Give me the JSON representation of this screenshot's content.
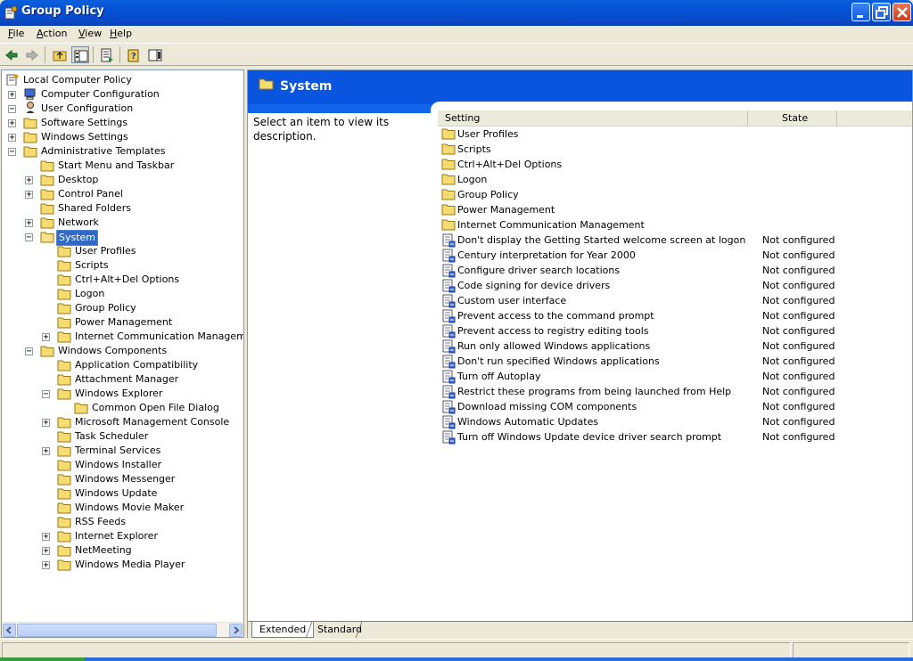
{
  "window": {
    "title": "Group Policy"
  },
  "menu": {
    "file": "File",
    "action": "Action",
    "view": "View",
    "help": "Help",
    "file_ul": "F",
    "file_rest": "ile",
    "action_ul": "A",
    "action_rest": "ction",
    "view_ul": "V",
    "view_rest": "iew",
    "help_ul": "H",
    "help_rest": "elp"
  },
  "tree": [
    {
      "label": "Local Computer Policy"
    },
    {
      "label": "Computer Configuration"
    },
    {
      "label": "User Configuration"
    },
    {
      "label": "Software Settings"
    },
    {
      "label": "Windows Settings"
    },
    {
      "label": "Administrative Templates"
    },
    {
      "label": "Start Menu and Taskbar"
    },
    {
      "label": "Desktop"
    },
    {
      "label": "Control Panel"
    },
    {
      "label": "Shared Folders"
    },
    {
      "label": "Network"
    },
    {
      "label": "System"
    },
    {
      "label": "User Profiles"
    },
    {
      "label": "Scripts"
    },
    {
      "label": "Ctrl+Alt+Del Options"
    },
    {
      "label": "Logon"
    },
    {
      "label": "Group Policy"
    },
    {
      "label": "Power Management"
    },
    {
      "label": "Internet Communication Manageme"
    },
    {
      "label": "Windows Components"
    },
    {
      "label": "Application Compatibility"
    },
    {
      "label": "Attachment Manager"
    },
    {
      "label": "Windows Explorer"
    },
    {
      "label": "Common Open File Dialog"
    },
    {
      "label": "Microsoft Management Console"
    },
    {
      "label": "Task Scheduler"
    },
    {
      "label": "Terminal Services"
    },
    {
      "label": "Windows Installer"
    },
    {
      "label": "Windows Messenger"
    },
    {
      "label": "Windows Update"
    },
    {
      "label": "Windows Movie Maker"
    },
    {
      "label": "RSS Feeds"
    },
    {
      "label": "Internet Explorer"
    },
    {
      "label": "NetMeeting"
    },
    {
      "label": "Windows Media Player"
    }
  ],
  "details": {
    "title": "System",
    "description": "Select an item to view its description.",
    "columns": {
      "setting": "Setting",
      "state": "State"
    },
    "folders": [
      "User Profiles",
      "Scripts",
      "Ctrl+Alt+Del Options",
      "Logon",
      "Group Policy",
      "Power Management",
      "Internet Communication Management"
    ],
    "settings": [
      {
        "name": "Don't display the Getting Started welcome screen at logon",
        "state": "Not configured"
      },
      {
        "name": "Century interpretation for Year 2000",
        "state": "Not configured"
      },
      {
        "name": "Configure driver search locations",
        "state": "Not configured"
      },
      {
        "name": "Code signing for device drivers",
        "state": "Not configured"
      },
      {
        "name": "Custom user interface",
        "state": "Not configured"
      },
      {
        "name": "Prevent access to the command prompt",
        "state": "Not configured"
      },
      {
        "name": "Prevent access to registry editing tools",
        "state": "Not configured"
      },
      {
        "name": "Run only allowed Windows applications",
        "state": "Not configured"
      },
      {
        "name": "Don't run specified Windows applications",
        "state": "Not configured"
      },
      {
        "name": "Turn off Autoplay",
        "state": "Not configured"
      },
      {
        "name": "Restrict these programs from being launched from Help",
        "state": "Not configured"
      },
      {
        "name": "Download missing COM components",
        "state": "Not configured"
      },
      {
        "name": "Windows Automatic Updates",
        "state": "Not configured"
      },
      {
        "name": "Turn off Windows Update device driver search prompt",
        "state": "Not configured"
      }
    ]
  },
  "tabs": {
    "extended": "Extended",
    "standard": "Standard"
  },
  "colors": {
    "titlebar": "#0a55e0",
    "selection": "#316ac5",
    "banner": "#0a55e0"
  }
}
